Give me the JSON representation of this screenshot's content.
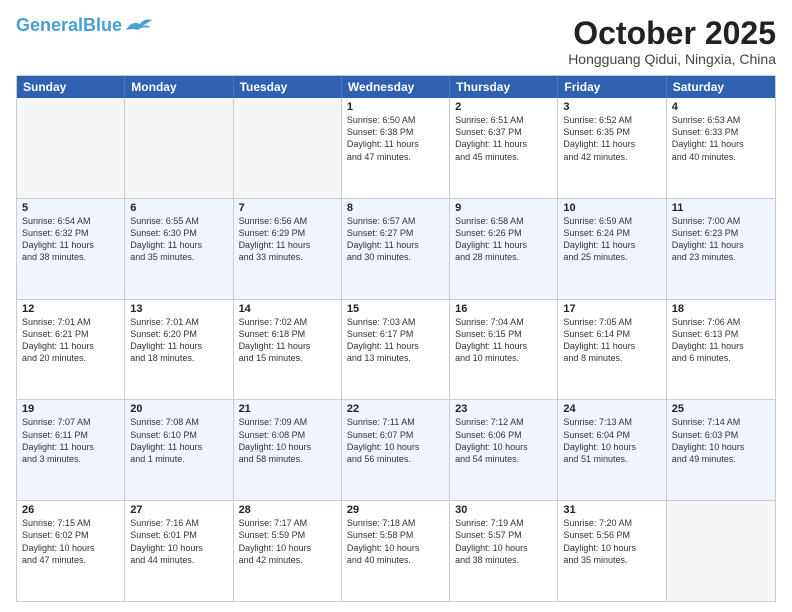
{
  "header": {
    "logo_general": "General",
    "logo_blue": "Blue",
    "month_title": "October 2025",
    "location": "Hongguang Qidui, Ningxia, China"
  },
  "weekdays": [
    "Sunday",
    "Monday",
    "Tuesday",
    "Wednesday",
    "Thursday",
    "Friday",
    "Saturday"
  ],
  "rows": [
    {
      "alt": false,
      "cells": [
        {
          "day": "",
          "text": ""
        },
        {
          "day": "",
          "text": ""
        },
        {
          "day": "",
          "text": ""
        },
        {
          "day": "1",
          "text": "Sunrise: 6:50 AM\nSunset: 6:38 PM\nDaylight: 11 hours\nand 47 minutes."
        },
        {
          "day": "2",
          "text": "Sunrise: 6:51 AM\nSunset: 6:37 PM\nDaylight: 11 hours\nand 45 minutes."
        },
        {
          "day": "3",
          "text": "Sunrise: 6:52 AM\nSunset: 6:35 PM\nDaylight: 11 hours\nand 42 minutes."
        },
        {
          "day": "4",
          "text": "Sunrise: 6:53 AM\nSunset: 6:33 PM\nDaylight: 11 hours\nand 40 minutes."
        }
      ]
    },
    {
      "alt": true,
      "cells": [
        {
          "day": "5",
          "text": "Sunrise: 6:54 AM\nSunset: 6:32 PM\nDaylight: 11 hours\nand 38 minutes."
        },
        {
          "day": "6",
          "text": "Sunrise: 6:55 AM\nSunset: 6:30 PM\nDaylight: 11 hours\nand 35 minutes."
        },
        {
          "day": "7",
          "text": "Sunrise: 6:56 AM\nSunset: 6:29 PM\nDaylight: 11 hours\nand 33 minutes."
        },
        {
          "day": "8",
          "text": "Sunrise: 6:57 AM\nSunset: 6:27 PM\nDaylight: 11 hours\nand 30 minutes."
        },
        {
          "day": "9",
          "text": "Sunrise: 6:58 AM\nSunset: 6:26 PM\nDaylight: 11 hours\nand 28 minutes."
        },
        {
          "day": "10",
          "text": "Sunrise: 6:59 AM\nSunset: 6:24 PM\nDaylight: 11 hours\nand 25 minutes."
        },
        {
          "day": "11",
          "text": "Sunrise: 7:00 AM\nSunset: 6:23 PM\nDaylight: 11 hours\nand 23 minutes."
        }
      ]
    },
    {
      "alt": false,
      "cells": [
        {
          "day": "12",
          "text": "Sunrise: 7:01 AM\nSunset: 6:21 PM\nDaylight: 11 hours\nand 20 minutes."
        },
        {
          "day": "13",
          "text": "Sunrise: 7:01 AM\nSunset: 6:20 PM\nDaylight: 11 hours\nand 18 minutes."
        },
        {
          "day": "14",
          "text": "Sunrise: 7:02 AM\nSunset: 6:18 PM\nDaylight: 11 hours\nand 15 minutes."
        },
        {
          "day": "15",
          "text": "Sunrise: 7:03 AM\nSunset: 6:17 PM\nDaylight: 11 hours\nand 13 minutes."
        },
        {
          "day": "16",
          "text": "Sunrise: 7:04 AM\nSunset: 6:15 PM\nDaylight: 11 hours\nand 10 minutes."
        },
        {
          "day": "17",
          "text": "Sunrise: 7:05 AM\nSunset: 6:14 PM\nDaylight: 11 hours\nand 8 minutes."
        },
        {
          "day": "18",
          "text": "Sunrise: 7:06 AM\nSunset: 6:13 PM\nDaylight: 11 hours\nand 6 minutes."
        }
      ]
    },
    {
      "alt": true,
      "cells": [
        {
          "day": "19",
          "text": "Sunrise: 7:07 AM\nSunset: 6:11 PM\nDaylight: 11 hours\nand 3 minutes."
        },
        {
          "day": "20",
          "text": "Sunrise: 7:08 AM\nSunset: 6:10 PM\nDaylight: 11 hours\nand 1 minute."
        },
        {
          "day": "21",
          "text": "Sunrise: 7:09 AM\nSunset: 6:08 PM\nDaylight: 10 hours\nand 58 minutes."
        },
        {
          "day": "22",
          "text": "Sunrise: 7:11 AM\nSunset: 6:07 PM\nDaylight: 10 hours\nand 56 minutes."
        },
        {
          "day": "23",
          "text": "Sunrise: 7:12 AM\nSunset: 6:06 PM\nDaylight: 10 hours\nand 54 minutes."
        },
        {
          "day": "24",
          "text": "Sunrise: 7:13 AM\nSunset: 6:04 PM\nDaylight: 10 hours\nand 51 minutes."
        },
        {
          "day": "25",
          "text": "Sunrise: 7:14 AM\nSunset: 6:03 PM\nDaylight: 10 hours\nand 49 minutes."
        }
      ]
    },
    {
      "alt": false,
      "cells": [
        {
          "day": "26",
          "text": "Sunrise: 7:15 AM\nSunset: 6:02 PM\nDaylight: 10 hours\nand 47 minutes."
        },
        {
          "day": "27",
          "text": "Sunrise: 7:16 AM\nSunset: 6:01 PM\nDaylight: 10 hours\nand 44 minutes."
        },
        {
          "day": "28",
          "text": "Sunrise: 7:17 AM\nSunset: 5:59 PM\nDaylight: 10 hours\nand 42 minutes."
        },
        {
          "day": "29",
          "text": "Sunrise: 7:18 AM\nSunset: 5:58 PM\nDaylight: 10 hours\nand 40 minutes."
        },
        {
          "day": "30",
          "text": "Sunrise: 7:19 AM\nSunset: 5:57 PM\nDaylight: 10 hours\nand 38 minutes."
        },
        {
          "day": "31",
          "text": "Sunrise: 7:20 AM\nSunset: 5:56 PM\nDaylight: 10 hours\nand 35 minutes."
        },
        {
          "day": "",
          "text": ""
        }
      ]
    }
  ]
}
